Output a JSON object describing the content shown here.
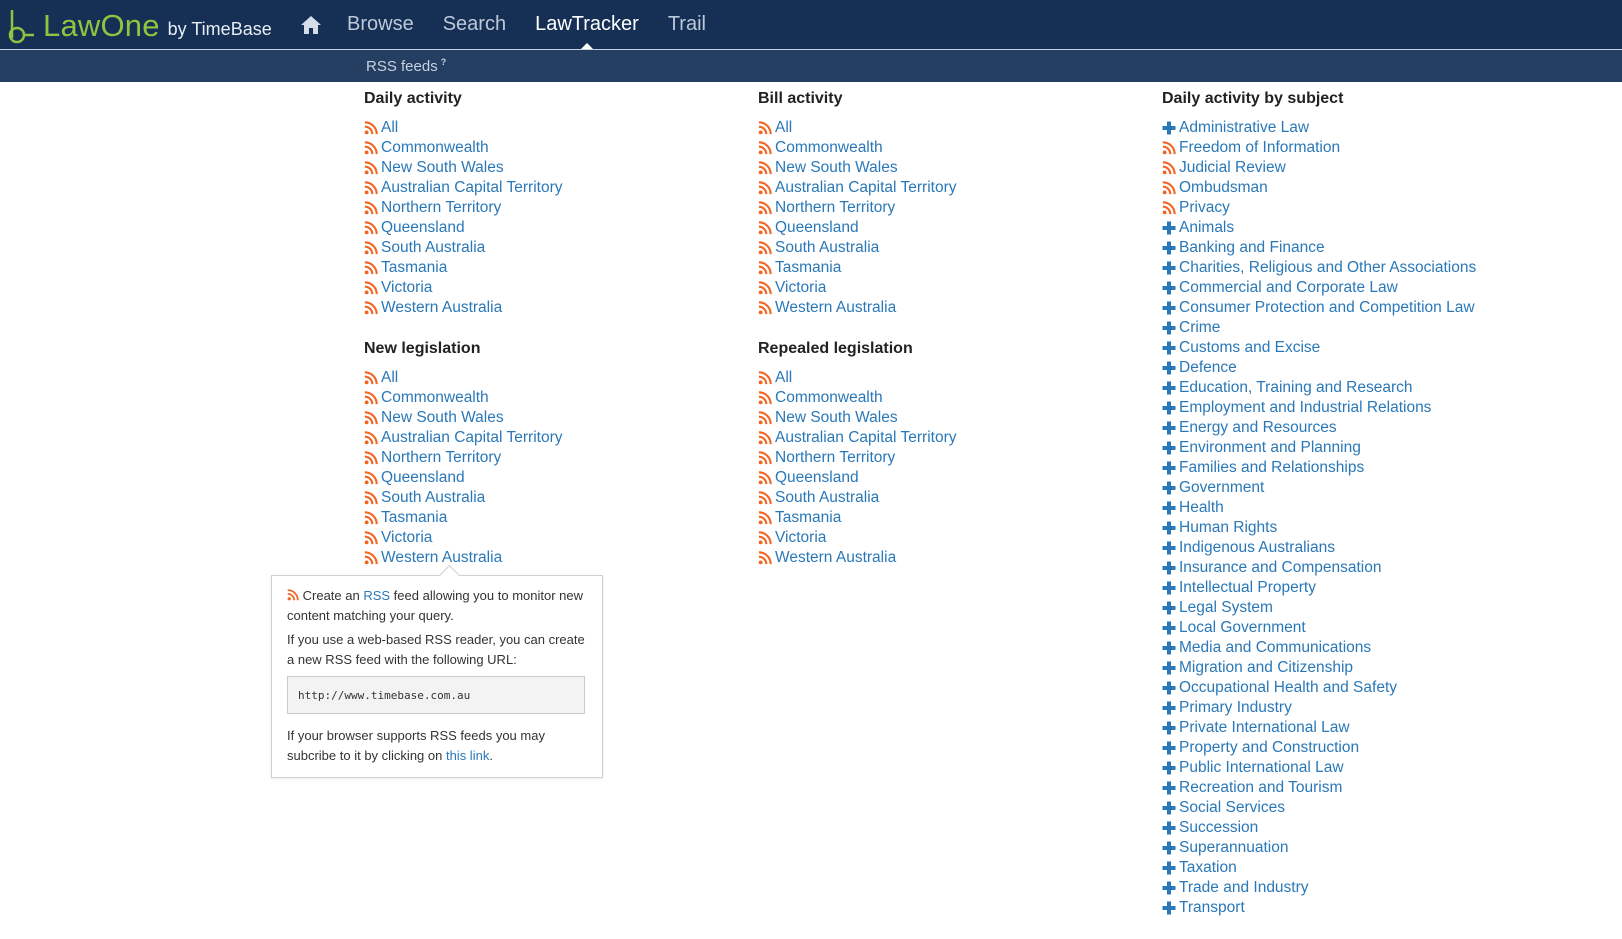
{
  "header": {
    "brand": "LawOne",
    "brand_suffix": "by TimeBase",
    "home_icon": "home-icon",
    "nav": [
      "Browse",
      "Search",
      "LawTracker",
      "Trail"
    ],
    "active_nav": "LawTracker"
  },
  "subnav": {
    "label": "RSS feeds",
    "help_mark": "?"
  },
  "colors": {
    "header_bg": "#163055",
    "subbar_bg": "#253f63",
    "brand_green": "#8cc640",
    "link_blue": "#2a78b8",
    "rss_orange": "#f26522"
  },
  "sections": {
    "daily_activity": {
      "title": "Daily activity",
      "items": [
        "All",
        "Commonwealth",
        "New South Wales",
        "Australian Capital Territory",
        "Northern Territory",
        "Queensland",
        "South Australia",
        "Tasmania",
        "Victoria",
        "Western Australia"
      ]
    },
    "new_legislation": {
      "title": "New legislation",
      "items": [
        "All",
        "Commonwealth",
        "New South Wales",
        "Australian Capital Territory",
        "Northern Territory",
        "Queensland",
        "South Australia",
        "Tasmania",
        "Victoria",
        "Western Australia"
      ]
    },
    "bill_activity": {
      "title": "Bill activity",
      "items": [
        "All",
        "Commonwealth",
        "New South Wales",
        "Australian Capital Territory",
        "Northern Territory",
        "Queensland",
        "South Australia",
        "Tasmania",
        "Victoria",
        "Western Australia"
      ]
    },
    "repealed_legislation": {
      "title": "Repealed legislation",
      "items": [
        "All",
        "Commonwealth",
        "New South Wales",
        "Australian Capital Territory",
        "Northern Territory",
        "Queensland",
        "South Australia",
        "Tasmania",
        "Victoria",
        "Western Australia"
      ]
    },
    "daily_by_subject": {
      "title": "Daily activity by subject",
      "items": [
        {
          "label": "Administrative Law",
          "icon": "plus-icon"
        },
        {
          "label": "Freedom of Information",
          "icon": "rss-icon"
        },
        {
          "label": "Judicial Review",
          "icon": "rss-icon"
        },
        {
          "label": "Ombudsman",
          "icon": "rss-icon"
        },
        {
          "label": "Privacy",
          "icon": "rss-icon"
        },
        {
          "label": "Animals",
          "icon": "plus-icon"
        },
        {
          "label": "Banking and Finance",
          "icon": "plus-icon"
        },
        {
          "label": "Charities, Religious and Other Associations",
          "icon": "plus-icon"
        },
        {
          "label": "Commercial and Corporate Law",
          "icon": "plus-icon"
        },
        {
          "label": "Consumer Protection and Competition Law",
          "icon": "plus-icon"
        },
        {
          "label": "Crime",
          "icon": "plus-icon"
        },
        {
          "label": "Customs and Excise",
          "icon": "plus-icon"
        },
        {
          "label": "Defence",
          "icon": "plus-icon"
        },
        {
          "label": "Education, Training and Research",
          "icon": "plus-icon"
        },
        {
          "label": "Employment and Industrial Relations",
          "icon": "plus-icon"
        },
        {
          "label": "Energy and Resources",
          "icon": "plus-icon"
        },
        {
          "label": "Environment and Planning",
          "icon": "plus-icon"
        },
        {
          "label": "Families and Relationships",
          "icon": "plus-icon"
        },
        {
          "label": "Government",
          "icon": "plus-icon"
        },
        {
          "label": "Health",
          "icon": "plus-icon"
        },
        {
          "label": "Human Rights",
          "icon": "plus-icon"
        },
        {
          "label": "Indigenous Australians",
          "icon": "plus-icon"
        },
        {
          "label": "Insurance and Compensation",
          "icon": "plus-icon"
        },
        {
          "label": "Intellectual Property",
          "icon": "plus-icon"
        },
        {
          "label": "Legal System",
          "icon": "plus-icon"
        },
        {
          "label": "Local Government",
          "icon": "plus-icon"
        },
        {
          "label": "Media and Communications",
          "icon": "plus-icon"
        },
        {
          "label": "Migration and Citizenship",
          "icon": "plus-icon"
        },
        {
          "label": "Occupational Health and Safety",
          "icon": "plus-icon"
        },
        {
          "label": "Primary Industry",
          "icon": "plus-icon"
        },
        {
          "label": "Private International Law",
          "icon": "plus-icon"
        },
        {
          "label": "Property and Construction",
          "icon": "plus-icon"
        },
        {
          "label": "Public International Law",
          "icon": "plus-icon"
        },
        {
          "label": "Recreation and Tourism",
          "icon": "plus-icon"
        },
        {
          "label": "Social Services",
          "icon": "plus-icon"
        },
        {
          "label": "Succession",
          "icon": "plus-icon"
        },
        {
          "label": "Superannuation",
          "icon": "plus-icon"
        },
        {
          "label": "Taxation",
          "icon": "plus-icon"
        },
        {
          "label": "Trade and Industry",
          "icon": "plus-icon"
        },
        {
          "label": "Transport",
          "icon": "plus-icon"
        }
      ]
    }
  },
  "popover": {
    "line1_pre": "Create an ",
    "line1_link": "RSS",
    "line1_post": " feed allowing you to monitor new content matching your query.",
    "line2": "If you use a web-based RSS reader, you can create a new RSS feed with the following URL:",
    "url": "http://www.timebase.com.au",
    "line3_pre": "If your browser supports RSS feeds you may subcribe to it by clicking on ",
    "line3_link": "this link",
    "line3_post": "."
  }
}
